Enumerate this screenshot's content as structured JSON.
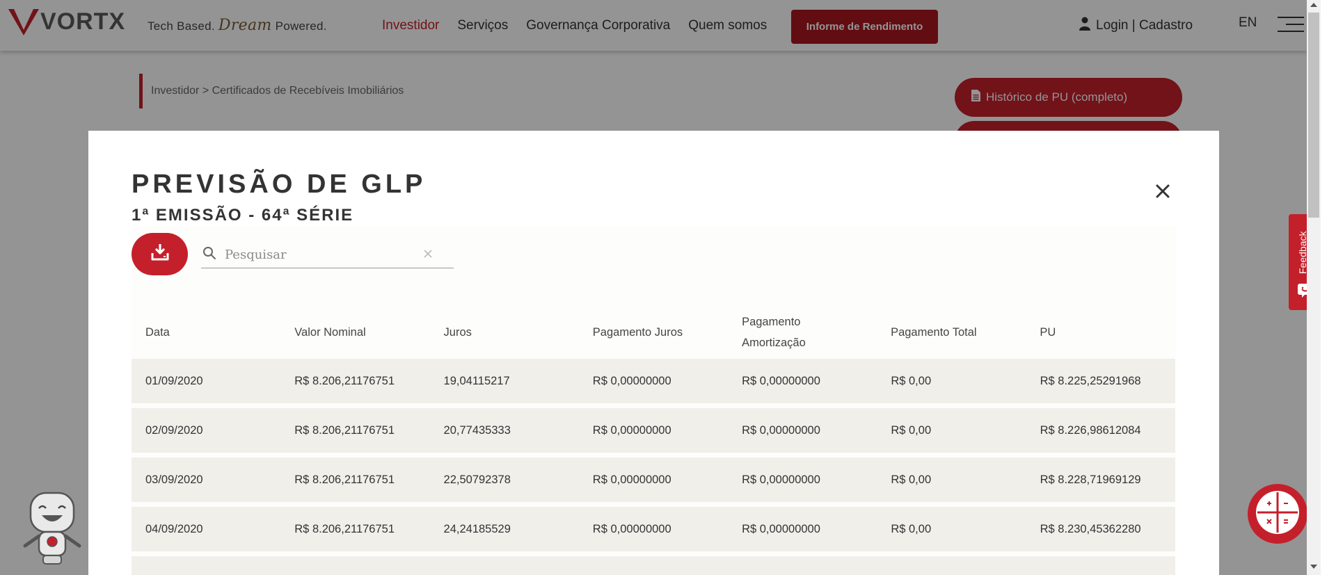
{
  "header": {
    "logo_text": "VORTX",
    "tagline_pre": "Tech Based.",
    "tagline_dream": "Dream",
    "tagline_post": "Powered.",
    "nav": [
      "Investidor",
      "Serviços",
      "Governança Corporativa",
      "Quem somos"
    ],
    "informe_button": "Informe de Rendimento",
    "login": "Login | Cadastro",
    "language": "EN"
  },
  "page": {
    "breadcrumb": "Investidor > Certificados de Recebíveis Imobiliários",
    "historico_button": "Histórico de PU (completo)"
  },
  "modal": {
    "title": "PREVISÃO DE GLP",
    "subtitle": "1ª EMISSÃO - 64ª SÉRIE",
    "search_placeholder": "Pesquisar",
    "columns": [
      "Data",
      "Valor Nominal",
      "Juros",
      "Pagamento Juros",
      "Pagamento Amortização",
      "Pagamento Total",
      "PU"
    ],
    "rows": [
      [
        "01/09/2020",
        "R$ 8.206,21176751",
        "19,04115217",
        "R$ 0,00000000",
        "R$ 0,00000000",
        "R$ 0,00",
        "R$ 8.225,25291968"
      ],
      [
        "02/09/2020",
        "R$ 8.206,21176751",
        "20,77435333",
        "R$ 0,00000000",
        "R$ 0,00000000",
        "R$ 0,00",
        "R$ 8.226,98612084"
      ],
      [
        "03/09/2020",
        "R$ 8.206,21176751",
        "22,50792378",
        "R$ 0,00000000",
        "R$ 0,00000000",
        "R$ 0,00",
        "R$ 8.228,71969129"
      ],
      [
        "04/09/2020",
        "R$ 8.206,21176751",
        "24,24185529",
        "R$ 0,00000000",
        "R$ 0,00000000",
        "R$ 0,00",
        "R$ 8.230,45362280"
      ]
    ]
  },
  "widgets": {
    "feedback_label": "Feedback"
  },
  "colors": {
    "brand_red": "#c4202b",
    "dark_red": "#a9181f",
    "row_bg": "#f0efea"
  }
}
